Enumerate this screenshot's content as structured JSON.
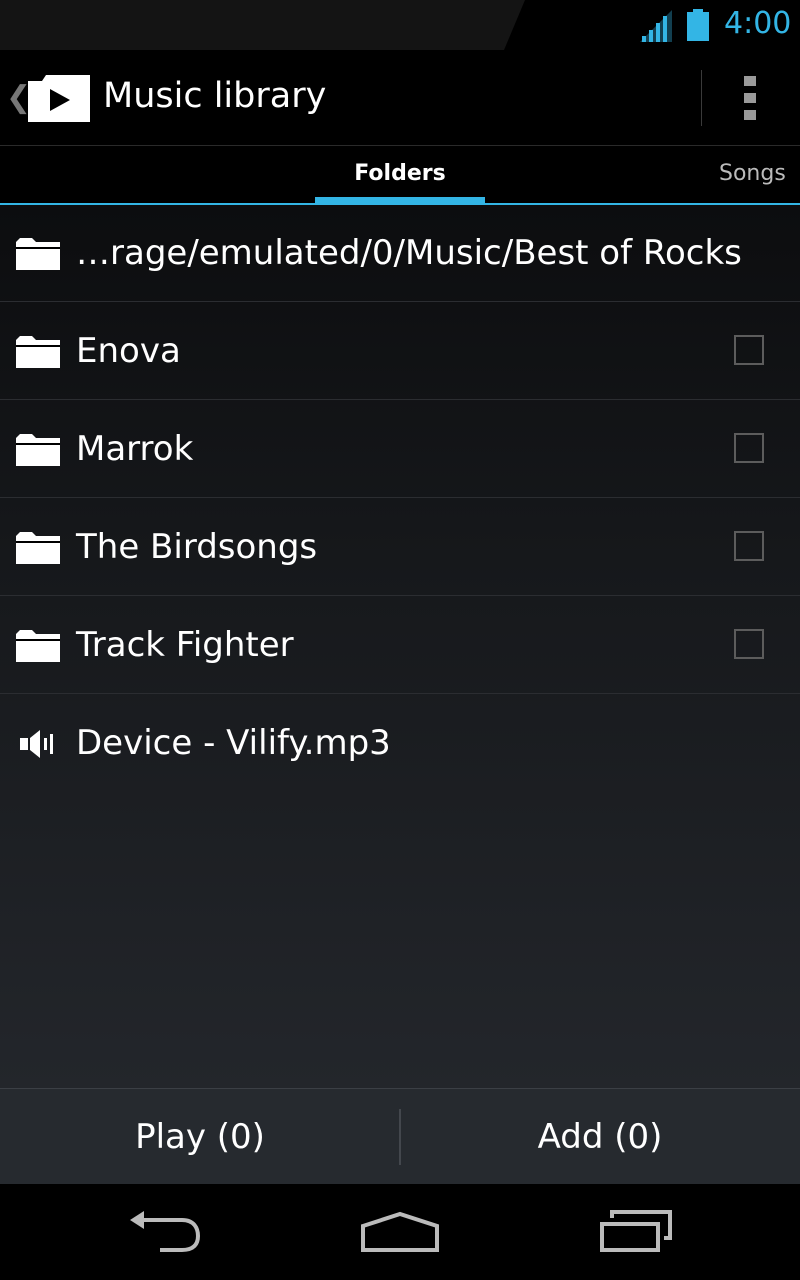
{
  "status_bar": {
    "time": "4:00",
    "accent_color": "#33b5e5"
  },
  "action_bar": {
    "title": "Music library",
    "icons": [
      "up-caret",
      "play-app-icon",
      "overflow-menu-icon"
    ]
  },
  "tabs": [
    {
      "label": "Folders",
      "selected": true
    },
    {
      "label": "Songs",
      "selected": false
    }
  ],
  "list": {
    "items": [
      {
        "label": "…rage/emulated/0/Music/Best of Rocks",
        "icon": "folder-icon",
        "has_checkbox": false
      },
      {
        "label": "Enova",
        "icon": "folder-icon",
        "has_checkbox": true,
        "checked": false
      },
      {
        "label": "Marrok",
        "icon": "folder-icon",
        "has_checkbox": true,
        "checked": false
      },
      {
        "label": "The Birdsongs",
        "icon": "folder-icon",
        "has_checkbox": true,
        "checked": false
      },
      {
        "label": "Track Fighter",
        "icon": "folder-icon",
        "has_checkbox": true,
        "checked": false
      },
      {
        "label": "Device - Vilify.mp3",
        "icon": "speaker-icon",
        "has_checkbox": false
      }
    ]
  },
  "buttons": {
    "play_label": "Play (0)",
    "add_label": "Add (0)"
  },
  "nav_bar": {
    "icons": [
      "back-icon",
      "home-icon",
      "recents-icon"
    ]
  }
}
